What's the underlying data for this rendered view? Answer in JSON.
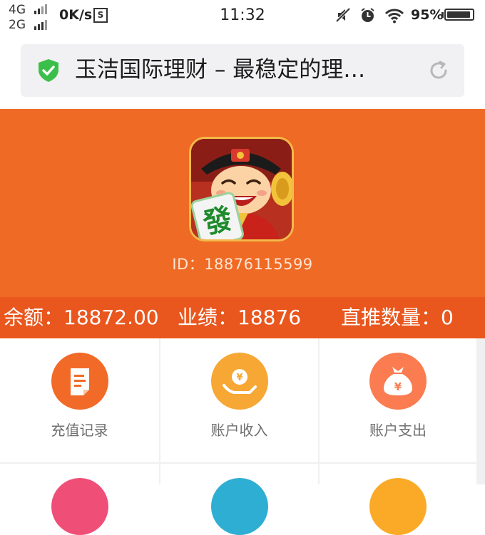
{
  "status_bar": {
    "network_top": "4G",
    "network_bottom": "2G",
    "speed": "0K/s",
    "app_badge": "S",
    "time": "11:32",
    "battery": "95%",
    "battery_level": 0.95
  },
  "browser": {
    "page_title": "玉洁国际理财 – 最稳定的理…",
    "secure_icon": "shield-check-icon",
    "reload_icon": "reload-icon"
  },
  "profile": {
    "id_text": "ID：18876115599",
    "avatar": "mahjong-character-avatar"
  },
  "stats": {
    "balance": "余额：18872.00",
    "performance": "业绩：18876",
    "direct_referrals": "直推数量：0"
  },
  "menu": [
    {
      "label": "充值记录",
      "icon": "document-icon",
      "color": "#f26a27"
    },
    {
      "label": "账户收入",
      "icon": "yuan-hand-icon",
      "color": "#f7a733"
    },
    {
      "label": "账户支出",
      "icon": "money-bag-icon",
      "color": "#fa7c50"
    },
    {
      "label": "",
      "icon": "",
      "color": "#ef4f77"
    },
    {
      "label": "",
      "icon": "",
      "color": "#2eaed2"
    },
    {
      "label": "",
      "icon": "",
      "color": "#fbaa27"
    }
  ],
  "colors": {
    "header_orange": "#ef6a24",
    "stats_orange": "#e9571e",
    "secure_green": "#3bbf4a"
  }
}
